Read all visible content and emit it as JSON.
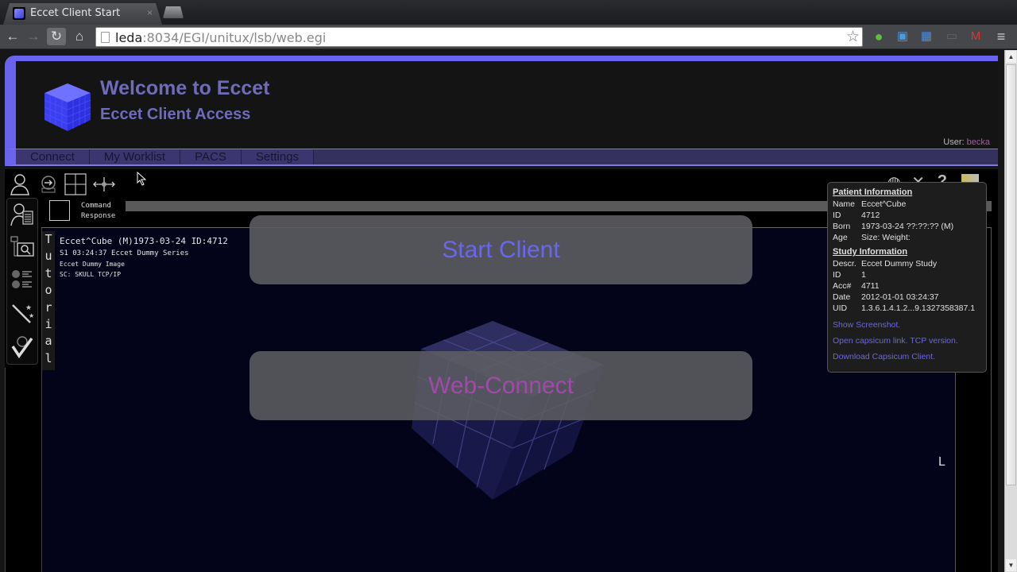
{
  "browser": {
    "tab_title": "Eccet Client Start",
    "tab_close": "×",
    "url_host": "leda",
    "url_rest": ":8034/EGI/unitux/lsb/web.egi",
    "icons": {
      "back": "←",
      "forward": "→",
      "reload": "↻",
      "home": "⌂",
      "star": "☆",
      "menu": "≡"
    }
  },
  "header": {
    "title": "Welcome to Eccet",
    "subtitle": "Eccet Client Access",
    "user_label": "User: ",
    "user_name": "becka"
  },
  "menu": {
    "items": [
      "Connect",
      "My Worklist",
      "PACS",
      "Settings"
    ]
  },
  "client": {
    "command_label_1": "Command",
    "command_label_2": "Response",
    "tutorial_letters": [
      "T",
      "u",
      "t",
      "o",
      "r",
      "i",
      "a",
      "l"
    ],
    "overlay": {
      "line1": "Eccet^Cube (M)1973-03-24 ID:4712",
      "line2": "S1 03:24:37 Eccet Dummy Series",
      "line3": "Eccet Dummy Image",
      "line4": "SC: SKULL TCP/IP"
    },
    "orientation_marker": "L",
    "start_button": "Start Client",
    "web_connect_button": "Web-Connect"
  },
  "info_popup": {
    "patient_heading": "Patient Information",
    "patient": [
      {
        "key": "Name",
        "value": "Eccet^Cube"
      },
      {
        "key": "ID",
        "value": "4712"
      },
      {
        "key": "Born",
        "value": "1973-03-24 ??:??:?? (M)"
      },
      {
        "key": "Age",
        "value": "Size: Weight:"
      }
    ],
    "study_heading": "Study Information",
    "study": [
      {
        "key": "Descr.",
        "value": "Eccet Dummy Study"
      },
      {
        "key": "ID",
        "value": "1"
      },
      {
        "key": "Acc#",
        "value": "4711"
      },
      {
        "key": "Date",
        "value": "2012-01-01 03:24:37"
      },
      {
        "key": "UID",
        "value": "1.3.6.1.4.1.2...9.1327358387.1"
      }
    ],
    "links": [
      "Show Screenshot.",
      "Open capsicum link. TCP version.",
      "Download Capsicum Client."
    ]
  },
  "colors": {
    "accent": "#6a63ee",
    "title_text": "#6e6bbb",
    "start_text": "#6a66f0",
    "web_connect_text": "#a04aa8",
    "user_name": "#a05aa5"
  }
}
